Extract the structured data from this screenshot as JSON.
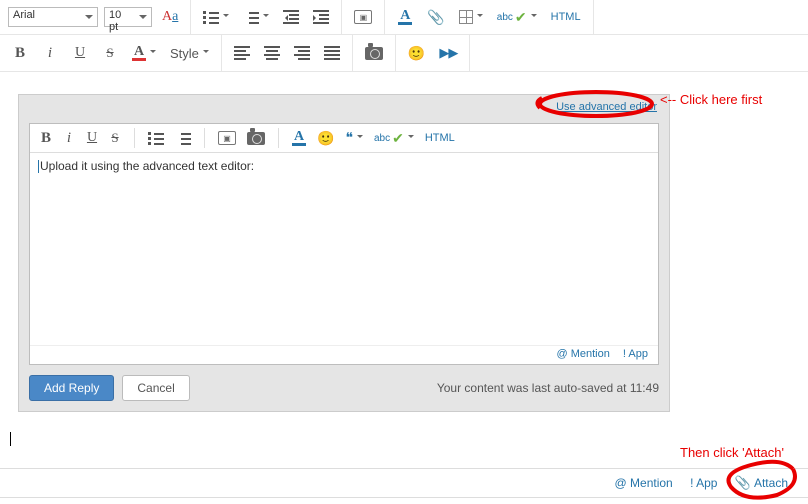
{
  "outer": {
    "font_family": "Arial",
    "font_size": "10 pt",
    "style_label": "Style",
    "html_label": "HTML"
  },
  "panel": {
    "advanced_link": "Use advanced editor",
    "body_text": "Upload it using the advanced text editor:",
    "html_label": "HTML",
    "footer_mention": "@ Mention",
    "footer_app": "! App",
    "add_reply": "Add Reply",
    "cancel": "Cancel",
    "autosave": "Your content was last auto-saved at 11:49"
  },
  "bottom": {
    "mention": "@ Mention",
    "app": "! App",
    "attach": "Attach"
  },
  "anno": {
    "first": "<-- Click here first",
    "second": "Then click 'Attach'"
  }
}
